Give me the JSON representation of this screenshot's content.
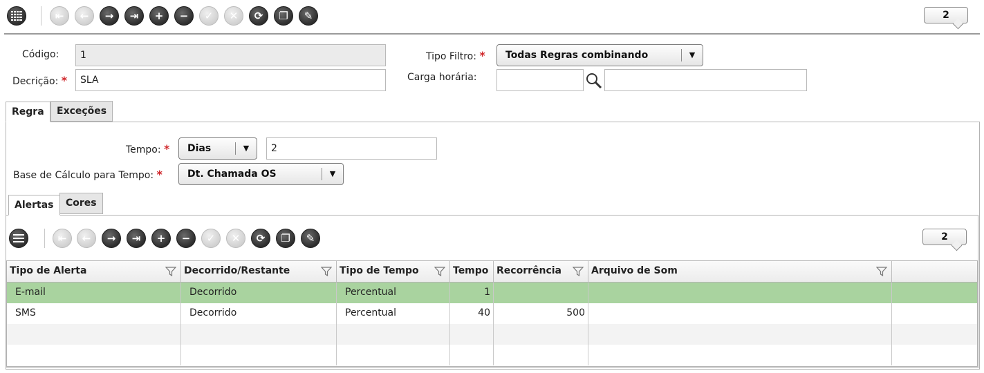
{
  "toolbar": {
    "counter": "2",
    "buttons": [
      {
        "name": "grid-menu-button",
        "icon": "grid-icon",
        "enabled": true
      },
      {
        "name": "first-record-button",
        "icon": "first-icon",
        "enabled": false
      },
      {
        "name": "prev-record-button",
        "icon": "arrow-left-icon",
        "enabled": false
      },
      {
        "name": "next-record-button",
        "icon": "arrow-right-icon",
        "enabled": true
      },
      {
        "name": "last-record-button",
        "icon": "last-icon",
        "enabled": true
      },
      {
        "name": "add-button",
        "icon": "plus-icon",
        "enabled": true
      },
      {
        "name": "remove-button",
        "icon": "minus-icon",
        "enabled": true
      },
      {
        "name": "confirm-button",
        "icon": "check-icon",
        "enabled": false
      },
      {
        "name": "cancel-button",
        "icon": "x-icon",
        "enabled": false
      },
      {
        "name": "refresh-button",
        "icon": "refresh-icon",
        "enabled": true
      },
      {
        "name": "copy-button",
        "icon": "copy-icon",
        "enabled": true
      },
      {
        "name": "attach-button",
        "icon": "paperclip-icon",
        "enabled": true
      }
    ]
  },
  "form": {
    "codigo_label": "Código:",
    "codigo_value": "1",
    "descricao_label": "Decrição:",
    "descricao_value": "SLA",
    "tipo_filtro_label": "Tipo Filtro:",
    "tipo_filtro_value": "Todas Regras combinando",
    "carga_label": "Carga horária:",
    "carga_code": "",
    "carga_desc": "",
    "required_mark": "*"
  },
  "tabs": {
    "outer": [
      {
        "label": "Regra"
      },
      {
        "label": "Exceções"
      }
    ],
    "inner": [
      {
        "label": "Alertas"
      },
      {
        "label": "Cores"
      }
    ]
  },
  "regra": {
    "tempo_label": "Tempo:",
    "tempo_unit": "Dias",
    "tempo_value": "2",
    "base_label": "Base de Cálculo para Tempo:",
    "base_value": "Dt. Chamada OS"
  },
  "alert_toolbar": {
    "counter": "2"
  },
  "grid": {
    "columns": [
      "Tipo de Alerta",
      "Decorrido/Restante",
      "Tipo de Tempo",
      "Tempo",
      "Recorrência",
      "Arquivo de Som"
    ],
    "rows": [
      [
        "E-mail",
        "Decorrido",
        "Percentual",
        "1",
        "",
        ""
      ],
      [
        "SMS",
        "Decorrido",
        "Percentual",
        "40",
        "500",
        ""
      ],
      [
        "",
        "",
        "",
        "",
        "",
        ""
      ],
      [
        "",
        "",
        "",
        "",
        "",
        ""
      ]
    ],
    "selected_row_color": "#a9d39f"
  },
  "colors": {
    "required": "#d0262a",
    "selected_row": "#a9d39f",
    "stripe": "#f3f3f3"
  }
}
